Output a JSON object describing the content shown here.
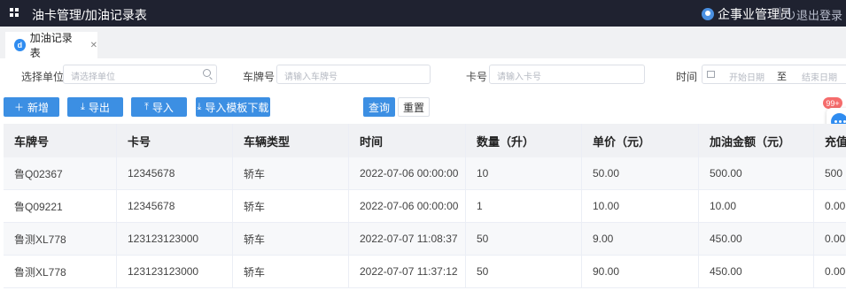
{
  "header": {
    "title": "油卡管理/加油记录表",
    "user_name": "企事业管理员",
    "logout_label": "退出登录"
  },
  "tabs": [
    {
      "label": "加油记录表",
      "icon": "d"
    }
  ],
  "filters": {
    "unit_label": "选择单位",
    "unit_placeholder": "请选择单位",
    "plate_label": "车牌号",
    "plate_placeholder": "请输入车牌号",
    "card_label": "卡号",
    "card_placeholder": "请输入卡号",
    "time_label": "时间",
    "start_placeholder": "开始日期",
    "range_separator": "至",
    "end_placeholder": "结束日期"
  },
  "toolbar": {
    "add_label": "新增",
    "export_label": "导出",
    "import_label": "导入",
    "template_label": "导入模板下载",
    "query_label": "查询",
    "reset_label": "重置"
  },
  "notification": {
    "badge": "99+"
  },
  "table": {
    "columns": [
      "车牌号",
      "卡号",
      "车辆类型",
      "时间",
      "数量（升）",
      "单价（元）",
      "加油金额（元）",
      "充值"
    ],
    "rows": [
      [
        "鲁Q02367",
        "12345678",
        "轿车",
        "2022-07-06 00:00:00",
        "10",
        "50.00",
        "500.00",
        "500"
      ],
      [
        "鲁Q09221",
        "12345678",
        "轿车",
        "2022-07-06 00:00:00",
        "1",
        "10.00",
        "10.00",
        "0.00"
      ],
      [
        "鲁测XL778",
        "123123123000",
        "轿车",
        "2022-07-07 11:08:37",
        "50",
        "9.00",
        "450.00",
        "0.00"
      ],
      [
        "鲁测XL778",
        "123123123000",
        "轿车",
        "2022-07-07 11:37:12",
        "50",
        "90.00",
        "450.00",
        "0.00"
      ]
    ]
  },
  "colors": {
    "topbar_bg": "#1f2230",
    "primary": "#3c8fe3",
    "badge": "#f56c6c"
  }
}
